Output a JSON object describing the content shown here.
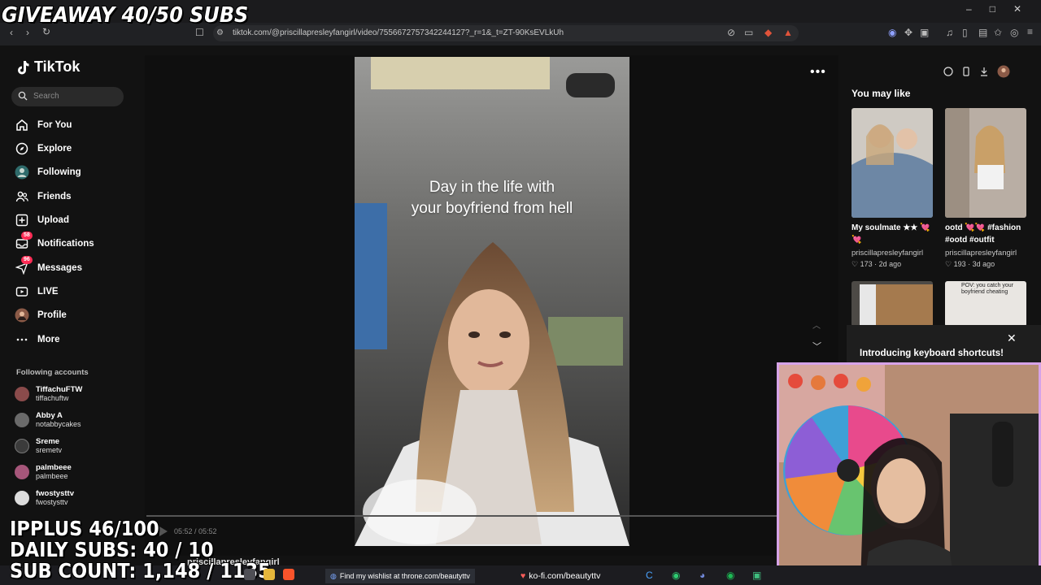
{
  "browser": {
    "url": "tiktok.com/@priscillapresleyfangirl/video/7556672757342244127?_r=1&_t=ZT-90KsEVLkUh",
    "window_controls": [
      "–",
      "□",
      "✕"
    ]
  },
  "overlay": {
    "giveaway": "GIVEAWAY 40/50 SUBS",
    "ipplus": "IPPLUS 46/100",
    "daily_subs": "DAILY SUBS: 40 / 10",
    "sub_count": "SUB COUNT: 1,148 / 1135"
  },
  "tiktok": {
    "brand": "TikTok",
    "search_placeholder": "Search",
    "nav": [
      {
        "label": "For You",
        "icon": "home-icon"
      },
      {
        "label": "Explore",
        "icon": "compass-icon"
      },
      {
        "label": "Following",
        "icon": "following-avatar-icon"
      },
      {
        "label": "Friends",
        "icon": "friends-icon"
      },
      {
        "label": "Upload",
        "icon": "upload-icon"
      },
      {
        "label": "Notifications",
        "icon": "inbox-icon",
        "badge": "58"
      },
      {
        "label": "Messages",
        "icon": "send-icon",
        "badge": "96"
      },
      {
        "label": "LIVE",
        "icon": "live-icon"
      },
      {
        "label": "Profile",
        "icon": "profile-avatar-icon"
      },
      {
        "label": "More",
        "icon": "more-icon"
      }
    ],
    "following_header": "Following accounts",
    "following_accounts": [
      {
        "name": "TiffachuFTW",
        "handle": "tiffachuftw",
        "color": "#8a4b4b"
      },
      {
        "name": "Abby A",
        "handle": "notabbycakes",
        "color": "#6a6a6a"
      },
      {
        "name": "Sreme",
        "handle": "sremetv",
        "color": "#3b3b3b"
      },
      {
        "name": "palmbeee",
        "handle": "palmbeee",
        "color": "#a6567a"
      },
      {
        "name": "fwostysttv",
        "handle": "fwostysttv",
        "color": "#dcdcdc"
      }
    ]
  },
  "video": {
    "caption_line1": "Day in the life with",
    "caption_line2": "your boyfriend from hell",
    "time": "05:52 / 05:52",
    "username": "priscillapresleyfangirl"
  },
  "right_panel": {
    "heading": "You may like",
    "cards": [
      {
        "title": "My soulmate ★★ 💘💘",
        "user": "priscillapresleyfangirl",
        "meta": "♡ 173 · 2d ago"
      },
      {
        "title": "ootd 💘💘 #fashion #ootd #outfit",
        "user": "priscillapresleyfangirl",
        "meta": "♡ 193 · 3d ago"
      }
    ],
    "thumb_caption_4": "POV: you catch your boyfriend cheating",
    "keyboard_banner": "Introducing keyboard shortcuts!"
  },
  "taskbar": {
    "wishlist_text": "Find my wishlist at throne.com/beautyttv",
    "kofi_text": "ko-fi.com/beautyttv"
  },
  "colors": {
    "accent": "#fe2c55",
    "webcam_border": "#d6a3e8",
    "background": "#121212"
  }
}
